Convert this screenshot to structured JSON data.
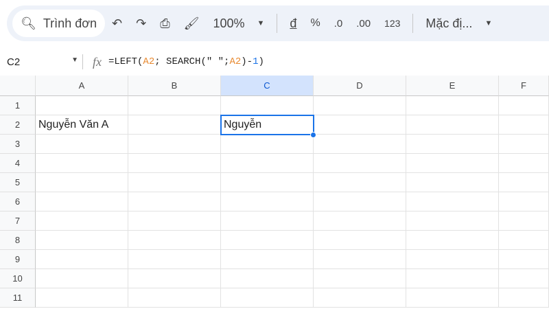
{
  "toolbar": {
    "search_label": "Trình đơn",
    "zoom": "100%",
    "currency": "đ",
    "percent": "%",
    "dec_decrease": ".0",
    "dec_increase": ".00",
    "number_format": "123",
    "font": "Mặc đị..."
  },
  "formula_bar": {
    "name_box": "C2",
    "formula_prefix": "=LEFT(",
    "ref1": "A2",
    "mid": "; SEARCH(\" \";",
    "ref2": "A2",
    "minus": ")-",
    "num": "1",
    "close": ")"
  },
  "columns": [
    "A",
    "B",
    "C",
    "D",
    "E",
    "F"
  ],
  "rows": [
    "1",
    "2",
    "3",
    "4",
    "5",
    "6",
    "7",
    "8",
    "9",
    "10",
    "11"
  ],
  "cells": {
    "A2": "Nguyễn Văn A",
    "C2": "Nguyễn"
  },
  "colors": {
    "accent": "#1a73e8",
    "toolbar_bg": "#eef2f9",
    "ref": "#e8892f"
  }
}
